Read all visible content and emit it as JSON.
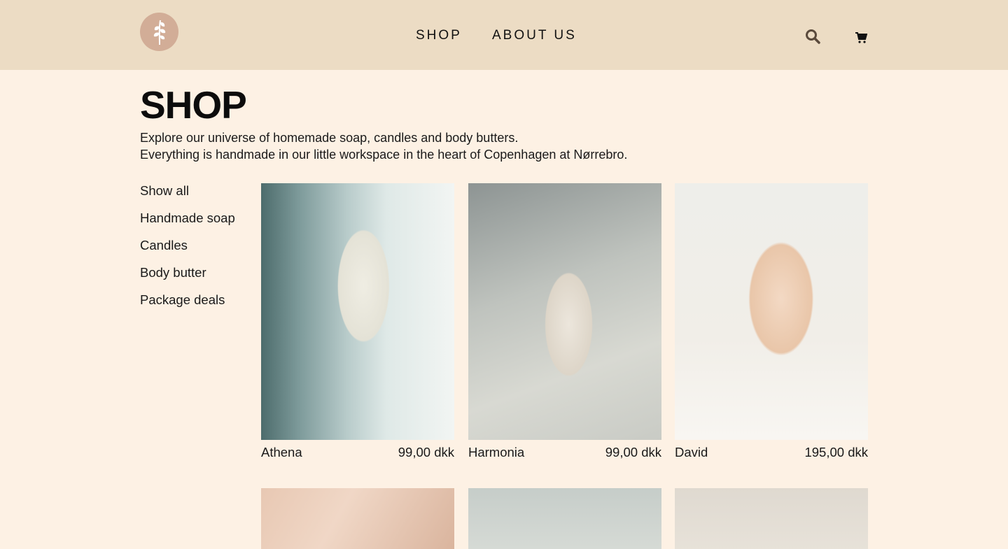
{
  "header": {
    "nav": [
      {
        "label": "SHOP"
      },
      {
        "label": "ABOUT US"
      }
    ],
    "icons": {
      "logo": "leaf-logo-icon",
      "search": "search-icon",
      "cart": "cart-icon"
    }
  },
  "colors": {
    "header_bg": "#ecdcc4",
    "page_bg": "#fdf1e4",
    "logo_bg": "#d2ad97"
  },
  "page": {
    "title": "SHOP",
    "intro_line1": "Explore our universe of homemade soap, candles and body butters.",
    "intro_line2": "Everything is handmade in our little workspace in the heart of Copenhagen at Nørrebro."
  },
  "sidebar": {
    "items": [
      {
        "label": "Show all"
      },
      {
        "label": "Handmade soap"
      },
      {
        "label": "Candles"
      },
      {
        "label": "Body butter"
      },
      {
        "label": "Package deals"
      }
    ]
  },
  "products": [
    {
      "name": "Athena",
      "price": "99,00 dkk"
    },
    {
      "name": "Harmonia",
      "price": "99,00 dkk"
    },
    {
      "name": "David",
      "price": "195,00 dkk"
    }
  ]
}
